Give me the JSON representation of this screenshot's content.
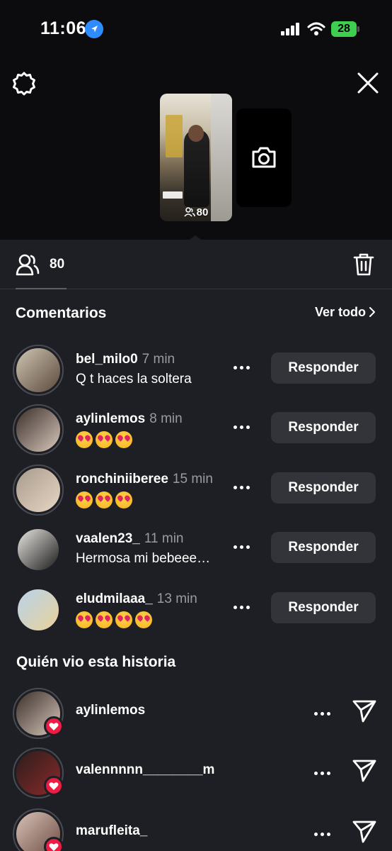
{
  "status_bar": {
    "time": "11:06",
    "battery": "28"
  },
  "story": {
    "viewer_count": "80"
  },
  "tabs": {
    "viewers_count": "80"
  },
  "comments_section": {
    "title": "Comentarios",
    "see_all": "Ver todo",
    "reply_label": "Responder",
    "items": [
      {
        "username": "bel_milo0",
        "time": "7 min",
        "text": "Q t haces la soltera",
        "emoji_count": 0,
        "avatar_colors": [
          "#cfc4b2",
          "#5b4a3c"
        ]
      },
      {
        "username": "aylinlemos",
        "time": "8 min",
        "text": "",
        "emoji_count": 3,
        "avatar_colors": [
          "#3a2f2a",
          "#d8c7bb"
        ]
      },
      {
        "username": "ronchiniiberee",
        "time": "15 min",
        "text": "",
        "emoji_count": 3,
        "avatar_colors": [
          "#a89a8c",
          "#e7d7c4"
        ]
      },
      {
        "username": "vaalen23_",
        "time": "11 min",
        "text": "Hermosa mi bebeee…",
        "emoji_count": 0,
        "avatar_colors": [
          "#e9e6e2",
          "#1b1b1b"
        ]
      },
      {
        "username": "eludmilaaa_",
        "time": "13 min",
        "text": "",
        "emoji_count": 4,
        "avatar_colors": [
          "#b8d3ea",
          "#e9d19a"
        ]
      }
    ]
  },
  "viewers_section": {
    "title": "Quién vio esta historia",
    "items": [
      {
        "username": "aylinlemos",
        "liked": true,
        "avatar_colors": [
          "#3a2f2a",
          "#d8c7bb"
        ]
      },
      {
        "username": "valennnnn________m",
        "liked": true,
        "avatar_colors": [
          "#2a1e1c",
          "#8c2a2a"
        ]
      },
      {
        "username": "marufleita_",
        "liked": true,
        "avatar_colors": [
          "#d9c2b8",
          "#6b4b40"
        ]
      }
    ]
  },
  "colors": {
    "panel_bg": "#1e1f24",
    "page_bg": "#0c0c0e",
    "button_bg": "#33343a",
    "like_red": "#ed1c45",
    "location_blue": "#2f8cff",
    "battery_green": "#3ecf4e"
  }
}
